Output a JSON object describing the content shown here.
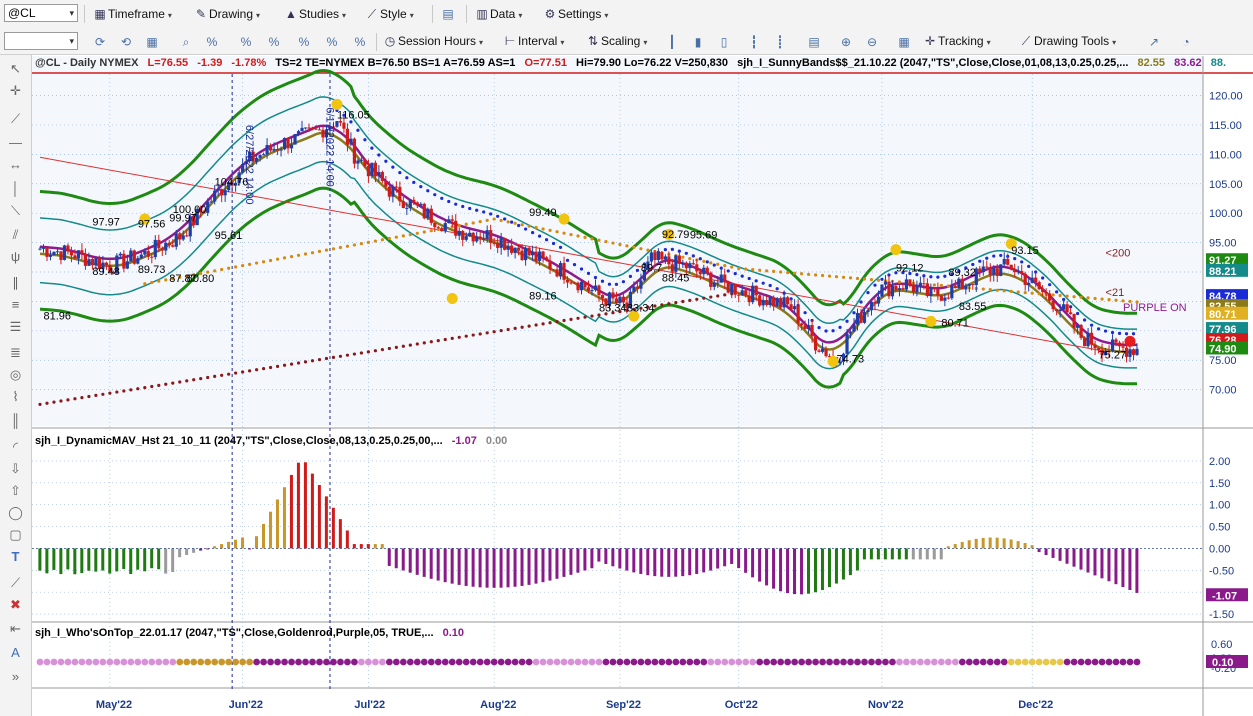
{
  "toolbar1": {
    "symbol": "@CL",
    "timeframe": "Timeframe",
    "drawing": "Drawing",
    "studies": "Studies",
    "style": "Style",
    "data": "Data",
    "settings": "Settings"
  },
  "toolbar2": {
    "session_hours": "Session Hours",
    "interval": "Interval",
    "scaling": "Scaling",
    "tracking": "Tracking",
    "drawing_tools": "Drawing Tools"
  },
  "colors": {
    "up": "#1f3fa8",
    "down": "#d11a1a",
    "band_outer": "#1f8a12",
    "band_inner": "#148a8a",
    "ma_purple": "#8e1b8e",
    "ma_olive": "#8a7a1a",
    "dots_blue": "#1a2ad6",
    "dots_orange": "#d68a10",
    "dots_maroon": "#8a1a1a",
    "hist_gold": "#c8962a",
    "hist_green": "#1f7a12",
    "hist_purple": "#8a1a8a",
    "hist_gray": "#9a9a9a",
    "hist_red": "#d11a1a"
  },
  "chart_data": [
    {
      "type": "candlestick",
      "header": {
        "symbol": "@CL - Daily  NYMEX",
        "last": "L=76.55",
        "chg": "-1.39",
        "pct": "-1.78%",
        "rest": "TS=2  TE=NYMEX  B=76.50  BS=1  A=76.59  AS=1",
        "open": "O=77.51",
        "hlv": "Hi=79.90  Lo=76.22  V=250,830",
        "study": "sjh_I_SunnyBands$$_21.10.22 (2047,\"TS\",Close,Close,01,08,13,0.25,0.25,...",
        "vals": [
          "82.55",
          "83.62",
          "88."
        ]
      },
      "x_labels": [
        "May'22",
        "Jun'22",
        "Jul'22",
        "Aug'22",
        "Sep'22",
        "Oct'22",
        "Nov'22",
        "Dec'22"
      ],
      "ylim": [
        64.5,
        124
      ],
      "y_ticks": [
        120,
        115,
        110,
        105,
        100,
        95,
        90,
        85,
        80,
        75,
        70
      ],
      "y_tick_labels": [
        "120.00",
        "115.00",
        "110.00",
        "105.00",
        "100.00",
        "95.00",
        "90.00",
        "85.00",
        "80.00",
        "75.00",
        "70.00"
      ],
      "annotations": [
        {
          "text": "97.97",
          "x": 15,
          "y": 97.9
        },
        {
          "text": "89.48",
          "x": 15,
          "y": 89.5
        },
        {
          "text": "81.96",
          "x": 1,
          "y": 81.9
        },
        {
          "text": "97.56",
          "x": 28,
          "y": 97.6
        },
        {
          "text": "89.73",
          "x": 28,
          "y": 89.8
        },
        {
          "text": "99.97",
          "x": 37,
          "y": 98.6
        },
        {
          "text": "87.87",
          "x": 37,
          "y": 88.3
        },
        {
          "text": "80.80",
          "x": 42,
          "y": 88.3
        },
        {
          "text": "100.00",
          "x": 38,
          "y": 100.0
        },
        {
          "text": "104.76",
          "x": 50,
          "y": 104.7
        },
        {
          "text": "95.61",
          "x": 50,
          "y": 95.6
        },
        {
          "text": "116.05",
          "x": 85,
          "y": 116.1
        },
        {
          "text": "99.49",
          "x": 140,
          "y": 99.5
        },
        {
          "text": "89.16",
          "x": 140,
          "y": 85.3
        },
        {
          "text": "89.7",
          "x": 172,
          "y": 90.1
        },
        {
          "text": "83.34",
          "x": 160,
          "y": 83.3
        },
        {
          "text": "83.34",
          "x": 168,
          "y": 83.3
        },
        {
          "text": "92.79",
          "x": 178,
          "y": 95.8
        },
        {
          "text": "95.69",
          "x": 186,
          "y": 95.7
        },
        {
          "text": "88.45",
          "x": 178,
          "y": 88.4
        },
        {
          "text": "92.12",
          "x": 245,
          "y": 90.1
        },
        {
          "text": "89.32",
          "x": 260,
          "y": 89.3
        },
        {
          "text": "83.55",
          "x": 263,
          "y": 83.5
        },
        {
          "text": "80.71",
          "x": 258,
          "y": 80.7
        },
        {
          "text": "93.15",
          "x": 278,
          "y": 93.1
        },
        {
          "text": "74.73",
          "x": 228,
          "y": 74.6
        },
        {
          "text": "75.27",
          "x": 303,
          "y": 75.3
        },
        {
          "text": "<200",
          "x": 305,
          "y": 92.6
        },
        {
          "text": "<21",
          "x": 305,
          "y": 85.9
        },
        {
          "text": "PURPLE ON",
          "x": 310,
          "y": 83.4
        },
        {
          "text": "6/27/2022 14:00",
          "x": 59,
          "y": 115
        },
        {
          "text": "6/17/2022 14:00",
          "x": 82,
          "y": 118
        }
      ],
      "right_badges": [
        {
          "text": "91.27",
          "y": 92.0,
          "color": "#1f8a12"
        },
        {
          "text": "88.21",
          "y": 90.2,
          "color": "#148a8a"
        },
        {
          "text": "84.78",
          "y": 85.9,
          "color": "#1a2ad6"
        },
        {
          "text": "82.55",
          "y": 84.2,
          "color": "#8a7a1a"
        },
        {
          "text": "80.71",
          "y": 82.9,
          "color": "#e0b020"
        },
        {
          "text": "77.96",
          "y": 80.3,
          "color": "#148a8a"
        },
        {
          "text": "76.28",
          "y": 78.4,
          "color": "#d11a1a"
        },
        {
          "text": "74.90",
          "y": 77.0,
          "color": "#1f8a12"
        }
      ]
    },
    {
      "type": "bar",
      "title": "sjh_I_DynamicMAV_Hst 21_10_11 (2047,\"TS\",Close,Close,08,13,0.25,0.25,00,...",
      "values_text": [
        "-1.07",
        "0.00"
      ],
      "ylim": [
        -1.75,
        2.25
      ],
      "y_ticks": [
        2.0,
        1.5,
        1.0,
        0.5,
        0.0,
        -0.5,
        -1.0,
        -1.5
      ],
      "y_tick_labels": [
        "2.00",
        "1.50",
        "1.00",
        "0.50",
        "0.00",
        "-0.50",
        "-1.00",
        "-1.50"
      ],
      "badge": "-1.07"
    },
    {
      "type": "dots",
      "title": "sjh_I_Who'sOnTop_22.01.17 (2047,\"TS\",Close,Goldenrod,Purple,05, TRUE,...",
      "value_text": "0.10",
      "y_ticks": [
        "0.60",
        "0.20",
        "-0.20"
      ],
      "badge": "0.10",
      "segments": [
        {
          "from": 0,
          "to": 38,
          "color": "#d890d8"
        },
        {
          "from": 39,
          "to": 60,
          "color": "#c8962a"
        },
        {
          "from": 61,
          "to": 90,
          "color": "#8a1a8a"
        },
        {
          "from": 91,
          "to": 98,
          "color": "#d890d8"
        },
        {
          "from": 99,
          "to": 140,
          "color": "#8a1a8a"
        },
        {
          "from": 141,
          "to": 160,
          "color": "#d890d8"
        },
        {
          "from": 161,
          "to": 190,
          "color": "#8a1a8a"
        },
        {
          "from": 191,
          "to": 205,
          "color": "#d890d8"
        },
        {
          "from": 206,
          "to": 245,
          "color": "#8a1a8a"
        },
        {
          "from": 246,
          "to": 262,
          "color": "#d890d8"
        },
        {
          "from": 263,
          "to": 277,
          "color": "#8a1a8a"
        },
        {
          "from": 278,
          "to": 292,
          "color": "#e8c84a"
        },
        {
          "from": 293,
          "to": 314,
          "color": "#8a1a8a"
        }
      ]
    }
  ]
}
